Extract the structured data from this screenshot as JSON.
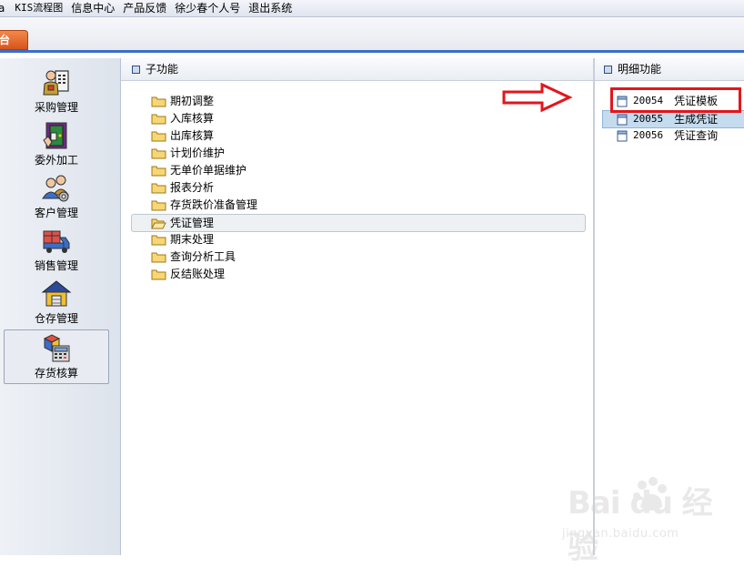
{
  "menu": {
    "items": [
      "a",
      "KIS流程图",
      "信息中心",
      "产品反馈",
      "徐少春个人号",
      "退出系统"
    ]
  },
  "toolbar": {
    "tab_label": "台"
  },
  "leftnav": {
    "items": [
      {
        "label": "采购管理",
        "icon": "purchase-icon"
      },
      {
        "label": "委外加工",
        "icon": "outsource-door-icon"
      },
      {
        "label": "客户管理",
        "icon": "customers-icon"
      },
      {
        "label": "销售管理",
        "icon": "delivery-truck-icon"
      },
      {
        "label": "仓存管理",
        "icon": "warehouse-icon"
      },
      {
        "label": "存货核算",
        "icon": "inventory-calculator-icon"
      }
    ],
    "active": "存货核算"
  },
  "subfunctions": {
    "title": "子功能",
    "items": [
      "期初调整",
      "入库核算",
      "出库核算",
      "计划价维护",
      "无单价单据维护",
      "报表分析",
      "存货跌价准备管理",
      "凭证管理",
      "期末处理",
      "查询分析工具",
      "反结账处理"
    ],
    "selected": "凭证管理"
  },
  "details": {
    "title": "明细功能",
    "items": [
      {
        "code": "20054",
        "name": "凭证模板"
      },
      {
        "code": "20055",
        "name": "生成凭证"
      },
      {
        "code": "20056",
        "name": "凭证查询"
      }
    ],
    "selected": "20055",
    "highlighted": "20054"
  },
  "watermark": {
    "main": "Bai du 经验",
    "sub": "jingyan.baidu.com"
  },
  "colors": {
    "accent_blue": "#3a6ec8",
    "tab_orange": "#d8541c",
    "annotation_red": "#e3161c",
    "selection_blue": "#c5dcef"
  }
}
